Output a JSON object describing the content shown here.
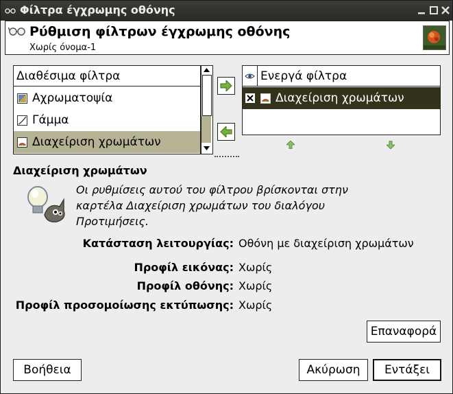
{
  "window": {
    "title": "Φίλτρα έγχρωμης οθόνης"
  },
  "header": {
    "title": "Ρύθμιση φίλτρων έγχρωμης οθόνης",
    "subtitle": "Χωρίς όνομα-1"
  },
  "available": {
    "heading": "Διαθέσιμα φίλτρα",
    "items": [
      "Αχρωματοψία",
      "Γάμμα",
      "Διαχείριση χρωμάτων"
    ]
  },
  "active": {
    "heading": "Ενεργά φίλτρα",
    "items": [
      "Διαχείριση χρωμάτων"
    ]
  },
  "details": {
    "heading": "Διαχείριση χρωμάτων",
    "description": [
      "Οι ρυθμίσεις αυτού του φίλτρου βρίσκονται στην",
      "καρτέλα Διαχείριση χρωμάτων του διαλόγου",
      "Προτιμήσεις."
    ],
    "fields": [
      {
        "label": "Κατάσταση λειτουργίας:",
        "value": "Οθόνη με διαχείριση χρωμάτων"
      },
      {
        "label": "Προφίλ εικόνας:",
        "value": "Χωρίς"
      },
      {
        "label": "Προφίλ οθόνης:",
        "value": "Χωρίς"
      },
      {
        "label": "Προφίλ προσομοίωσης εκτύπωσης:",
        "value": "Χωρίς"
      }
    ]
  },
  "buttons": {
    "reset": "Επαναφορά",
    "help": "Βοήθεια",
    "cancel": "Ακύρωση",
    "ok": "Εντάξει"
  },
  "colors": {
    "selected_row": "#b5b394",
    "active_row": "#35321c",
    "accent_green": "#74b33b"
  }
}
